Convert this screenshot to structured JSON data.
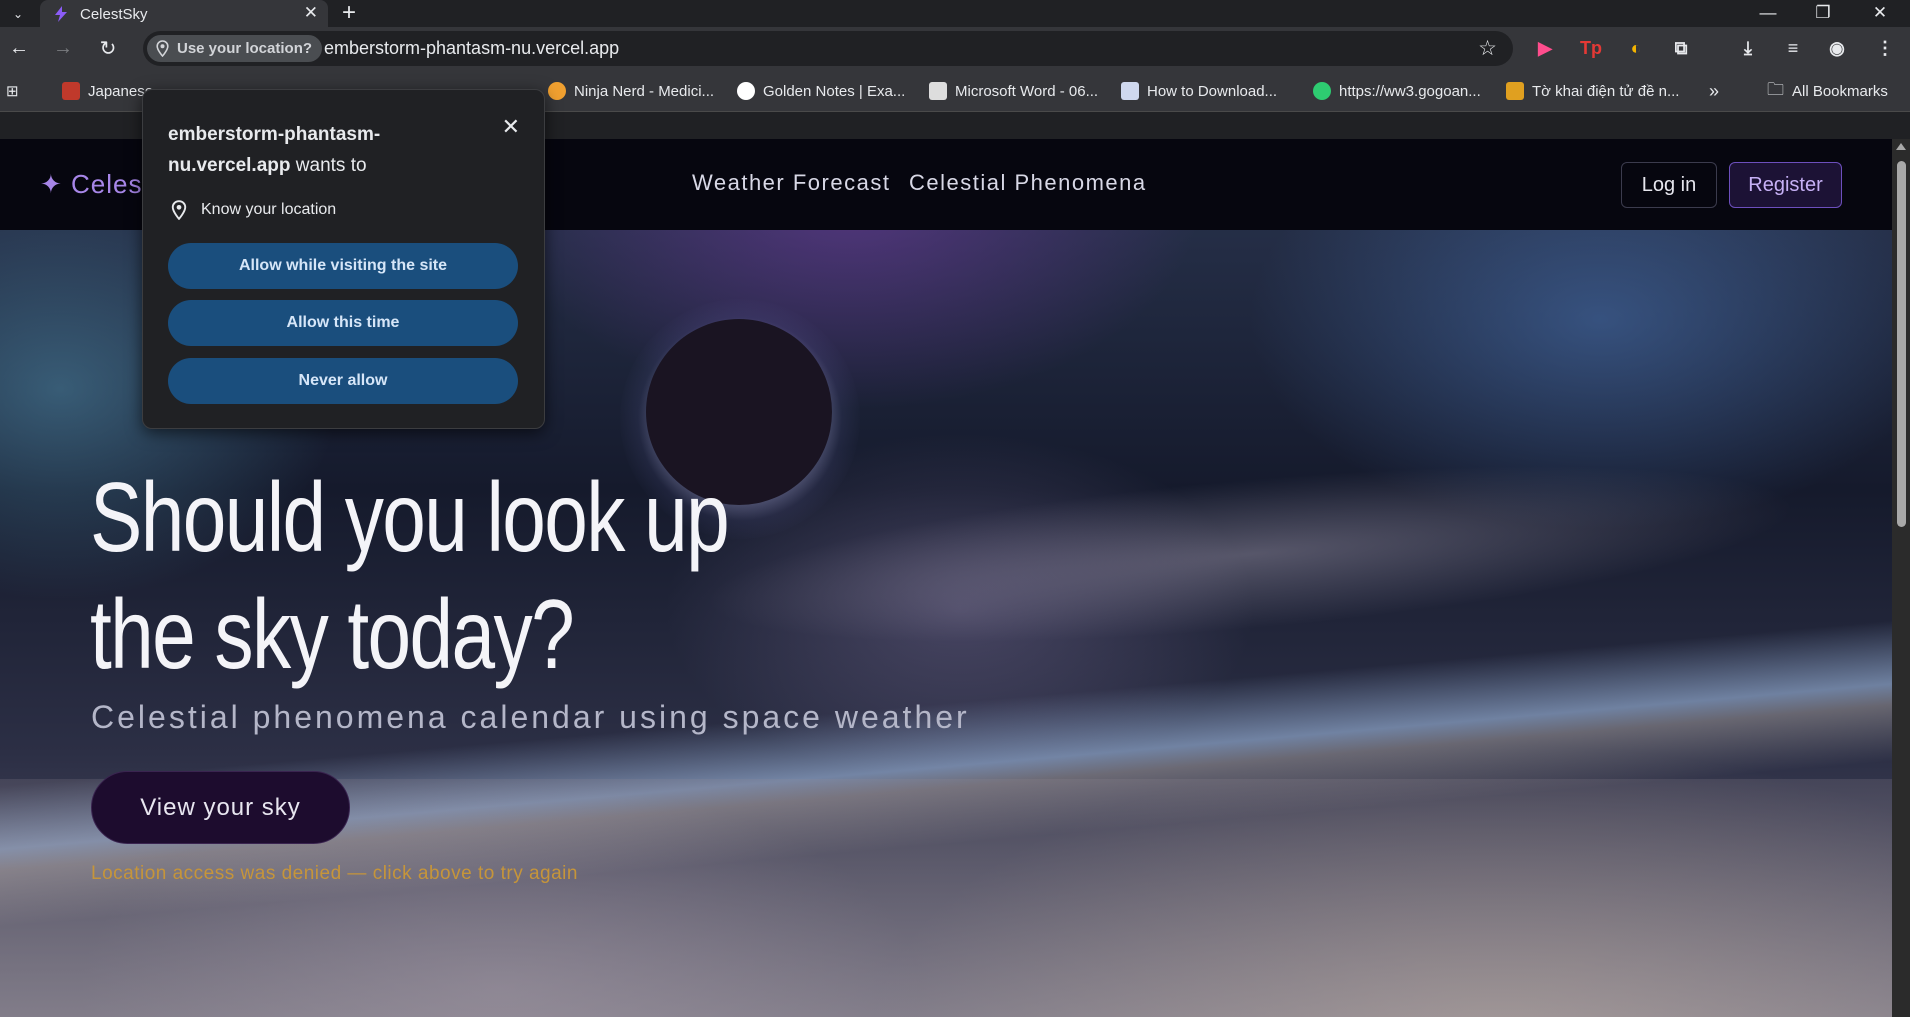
{
  "browser": {
    "tab_title": "CelestSky",
    "location_chip": "Use your location?",
    "url": "emberstorm-phantasm-nu.vercel.app"
  },
  "bookmarks": [
    {
      "label": "Japanese",
      "color": "#c0392b"
    },
    {
      "label": "Ninja Nerd - Medici...",
      "color": "#f0a030"
    },
    {
      "label": "Golden Notes | Exa...",
      "color": "#ffffff"
    },
    {
      "label": "Microsoft Word - 06...",
      "color": "#dddddd"
    },
    {
      "label": "How to Download...",
      "color": "#cfd8ee"
    },
    {
      "label": "https://ww3.gogoan...",
      "color": "#2ecc71"
    },
    {
      "label": "Tờ khai điện tử đề n...",
      "color": "#e0a020"
    },
    {
      "label": "All Bookmarks",
      "color": "#e8eaed"
    }
  ],
  "site": {
    "logo": "Celest",
    "nav": [
      "Weather Forecast",
      "Celestial Phenomena"
    ],
    "login": "Log in",
    "register": "Register",
    "headline_line1": "Should you look up",
    "headline_line2": "the sky today?",
    "subtitle": "Celestial phenomena calendar using space weather",
    "cta": "View your sky",
    "denied_message": "Location access was denied — click above to try again"
  },
  "popup": {
    "origin": "emberstorm-phantasm-nu.vercel.app",
    "wants_to": "wants to",
    "permission": "Know your location",
    "buttons": [
      "Allow while visiting the site",
      "Allow this time",
      "Never allow"
    ]
  },
  "colors": {
    "accent": "#a786e8",
    "popup_button": "#1a4e7d",
    "warning_text": "#c6953a"
  }
}
